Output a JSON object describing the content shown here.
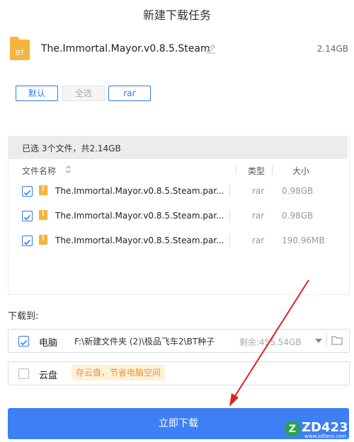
{
  "dialog": {
    "title": "新建下载任务"
  },
  "task": {
    "icon": "bt-file-icon",
    "icon_text": "BT",
    "name": "The.Immortal.Mayor.v0.8.5.Steam",
    "size": "2.14GB",
    "edit_icon": "pencil-icon"
  },
  "filters": [
    {
      "label": "默认",
      "state": "active"
    },
    {
      "label": "全选",
      "state": "inactive"
    },
    {
      "label": "rar",
      "state": "active"
    }
  ],
  "file_list": {
    "summary": "已选 3个文件，共2.14GB",
    "columns": {
      "name": "文件名称",
      "type": "类型",
      "size": "大小"
    },
    "rows": [
      {
        "checked": true,
        "name": "The.Immortal.Mayor.v0.8.5.Steam.par...",
        "type": "rar",
        "size": "0.98GB"
      },
      {
        "checked": true,
        "name": "The.Immortal.Mayor.v0.8.5.Steam.par...",
        "type": "rar",
        "size": "0.98GB"
      },
      {
        "checked": true,
        "name": "The.Immortal.Mayor.v0.8.5.Steam.par...",
        "type": "rar",
        "size": "190.96MB"
      }
    ]
  },
  "destination": {
    "label": "下载到:",
    "local": {
      "checked": true,
      "label": "电脑",
      "path": "F:\\新建文件夹 (2)\\极品飞车2\\BT种子",
      "free_space": "剩余:455.54GB"
    },
    "cloud": {
      "checked": false,
      "label": "云盘",
      "badge": "存云盘，节省电脑空间"
    }
  },
  "download_button": {
    "label": "立即下载"
  },
  "watermark": {
    "text": "ZD423",
    "sub": "www.zdfans.com"
  },
  "colors": {
    "accent": "#3d7ff4",
    "folder": "#f6b43c",
    "annotation_arrow": "#e02020"
  }
}
